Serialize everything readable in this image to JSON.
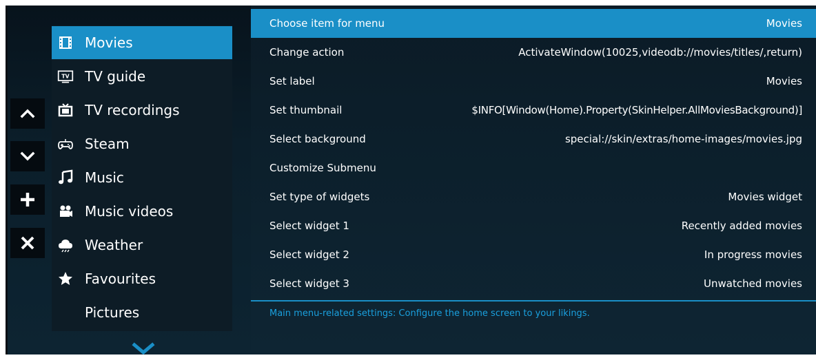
{
  "controls": [
    {
      "name": "move-up-button",
      "icon": "chevron-up-icon"
    },
    {
      "name": "move-down-button",
      "icon": "chevron-down-icon"
    },
    {
      "name": "add-button",
      "icon": "plus-icon"
    },
    {
      "name": "remove-button",
      "icon": "close-icon"
    }
  ],
  "menu": {
    "items": [
      {
        "label": "Movies",
        "icon": "film-icon"
      },
      {
        "label": "TV guide",
        "icon": "tv-icon"
      },
      {
        "label": "TV recordings",
        "icon": "recording-tv-icon"
      },
      {
        "label": "Steam",
        "icon": "gamepad-icon"
      },
      {
        "label": "Music",
        "icon": "music-note-icon"
      },
      {
        "label": "Music videos",
        "icon": "video-camera-icon"
      },
      {
        "label": "Weather",
        "icon": "weather-icon"
      },
      {
        "label": "Favourites",
        "icon": "star-icon"
      },
      {
        "label": "Pictures",
        "icon": ""
      }
    ],
    "selected_index": 0,
    "scroll_icon": "chevron-down-icon"
  },
  "settings": {
    "rows": [
      {
        "label": "Choose item for menu",
        "value": "Movies"
      },
      {
        "label": "Change action",
        "value": "ActivateWindow(10025,videodb://movies/titles/,return)"
      },
      {
        "label": "Set label",
        "value": "Movies"
      },
      {
        "label": "Set thumbnail",
        "value": "$INFO[Window(Home).Property(SkinHelper.AllMoviesBackground)]"
      },
      {
        "label": "Select background",
        "value": "special://skin/extras/home-images/movies.jpg"
      },
      {
        "label": "Customize Submenu",
        "value": ""
      },
      {
        "label": "Set type of widgets",
        "value": "Movies widget"
      },
      {
        "label": "Select widget 1",
        "value": "Recently added movies"
      },
      {
        "label": "Select widget 2",
        "value": "In progress movies"
      },
      {
        "label": "Select widget 3",
        "value": "Unwatched movies"
      }
    ],
    "selected_index": 0,
    "description": "Main menu-related settings: Configure the home screen to your likings."
  },
  "colors": {
    "accent": "#1a8fc7",
    "description_text": "#1aa0de",
    "background": "#0b1e2a"
  }
}
